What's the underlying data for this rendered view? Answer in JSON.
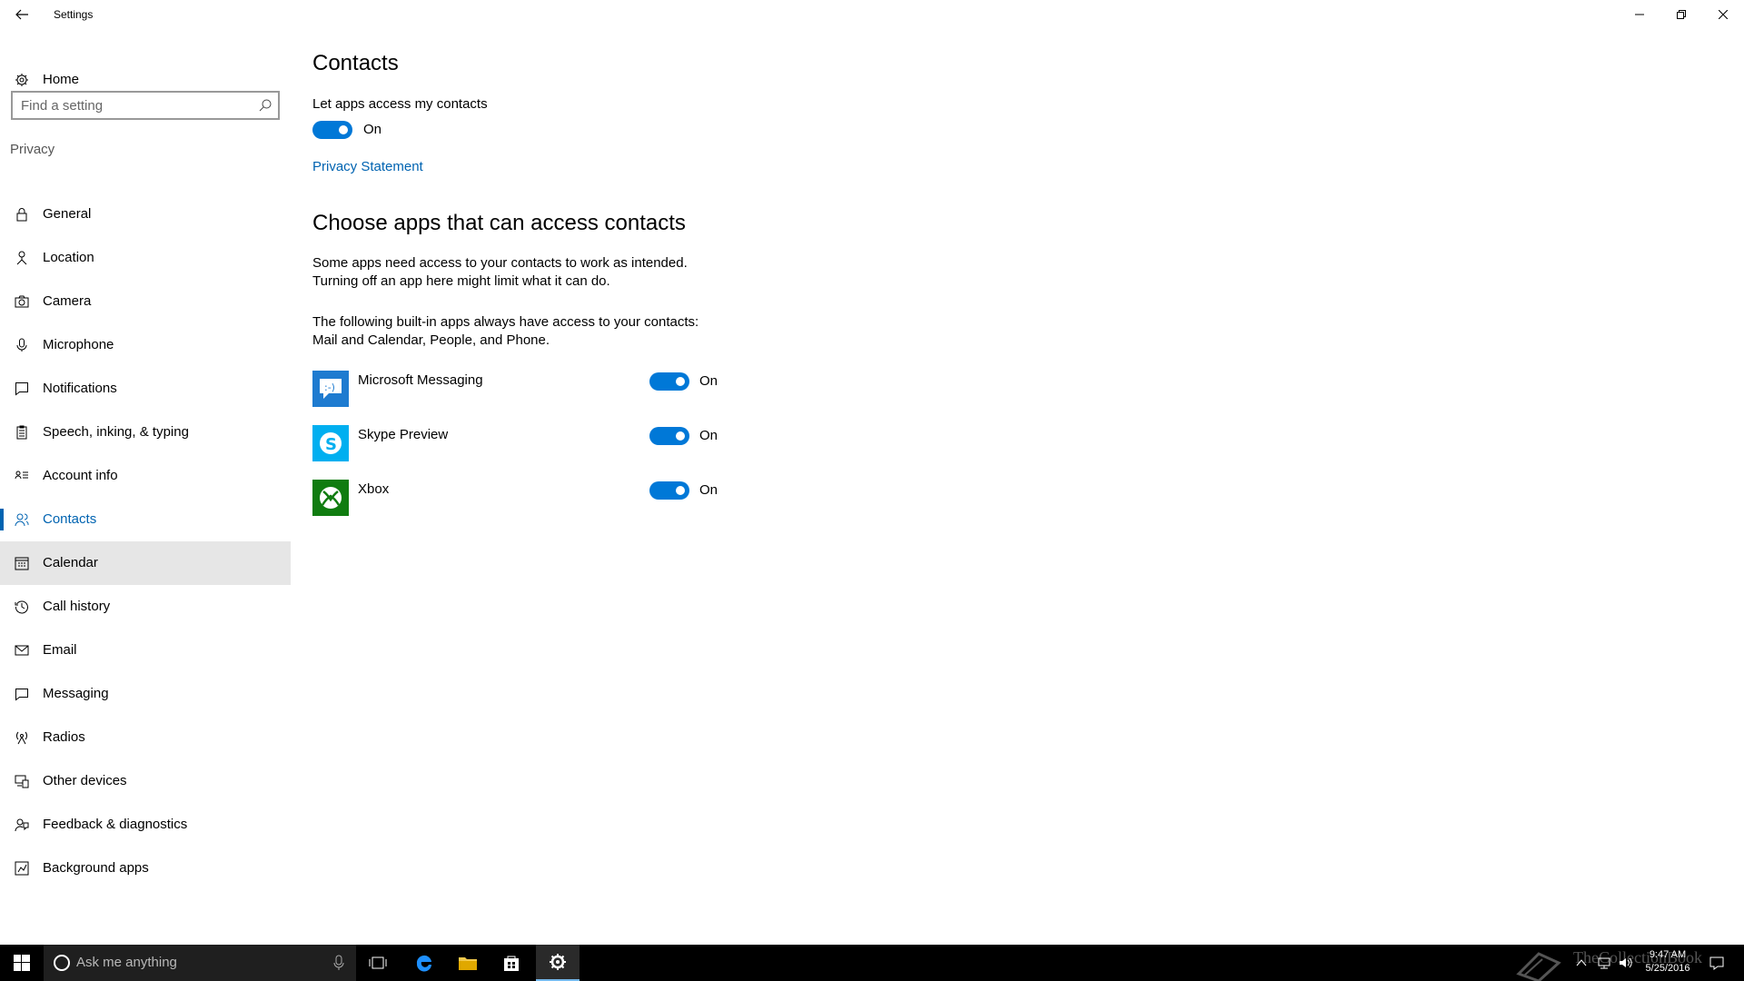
{
  "window": {
    "title": "Settings"
  },
  "sidebar": {
    "home_label": "Home",
    "search_placeholder": "Find a setting",
    "section_label": "Privacy",
    "items": [
      {
        "label": "General",
        "icon": "lock-icon"
      },
      {
        "label": "Location",
        "icon": "location-person-icon"
      },
      {
        "label": "Camera",
        "icon": "camera-icon"
      },
      {
        "label": "Microphone",
        "icon": "microphone-icon"
      },
      {
        "label": "Notifications",
        "icon": "speech-bubble-icon"
      },
      {
        "label": "Speech, inking, & typing",
        "icon": "clipboard-icon"
      },
      {
        "label": "Account info",
        "icon": "account-card-icon"
      },
      {
        "label": "Contacts",
        "icon": "contacts-icon",
        "selected": true
      },
      {
        "label": "Calendar",
        "icon": "calendar-icon",
        "hover": true
      },
      {
        "label": "Call history",
        "icon": "history-icon"
      },
      {
        "label": "Email",
        "icon": "mail-icon"
      },
      {
        "label": "Messaging",
        "icon": "message-icon"
      },
      {
        "label": "Radios",
        "icon": "radio-tower-icon"
      },
      {
        "label": "Other devices",
        "icon": "devices-icon"
      },
      {
        "label": "Feedback & diagnostics",
        "icon": "feedback-icon"
      },
      {
        "label": "Background apps",
        "icon": "background-apps-icon"
      }
    ]
  },
  "main": {
    "title": "Contacts",
    "access_label": "Let apps access my contacts",
    "access_toggle_state": "On",
    "privacy_link": "Privacy Statement",
    "choose_heading": "Choose apps that can access contacts",
    "description_line1": "Some apps need access to your contacts to work as intended.",
    "description_line2": "Turning off an app here might limit what it can do.",
    "builtin_line1": "The following built-in apps always have access to your contacts:",
    "builtin_line2": "Mail and Calendar, People, and Phone.",
    "apps": [
      {
        "name": "Microsoft Messaging",
        "state": "On",
        "icon": "messaging-smiley-icon",
        "icon_color": "#1e7bd0"
      },
      {
        "name": "Skype Preview",
        "state": "On",
        "icon": "skype-icon",
        "icon_color": "#00aff0"
      },
      {
        "name": "Xbox",
        "state": "On",
        "icon": "xbox-icon",
        "icon_color": "#107c10"
      }
    ]
  },
  "taskbar": {
    "search_placeholder": "Ask me anything",
    "time": "9:47 AM",
    "date": "5/25/2016",
    "watermark": "TheCollectionBook"
  },
  "colors": {
    "accent": "#0078d7",
    "link": "#0063b1",
    "hover_bg": "#e6e6e6",
    "taskbar_bg": "#000000"
  }
}
